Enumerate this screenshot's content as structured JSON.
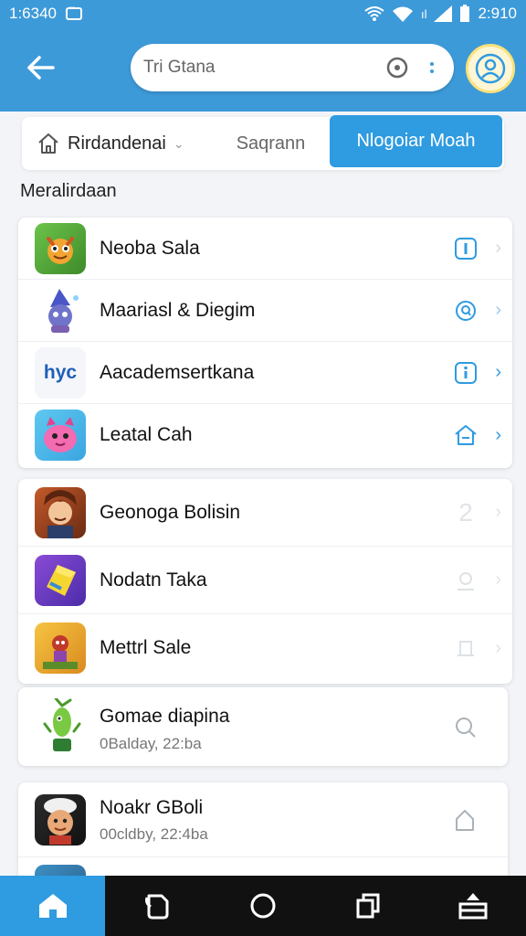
{
  "status_bar": {
    "time_left": "1:6340",
    "time_right": "2:910"
  },
  "search": {
    "placeholder": "Tri Gtana"
  },
  "tabs": {
    "home_label": "Rirdandenai",
    "second_label": "Saqrann",
    "active_button": "Nlogoiar Moah"
  },
  "section_title": "Meralirdaan",
  "group1": [
    {
      "title": "Neoba Sala",
      "action_icon": "info-icon"
    },
    {
      "title": "Maariasl & Diegim",
      "action_icon": "chat-icon"
    },
    {
      "title": "Aacademsertkana",
      "icon_text": "hyc",
      "action_icon": "info-icon"
    },
    {
      "title": "Leatal Cah",
      "action_icon": "home-icon"
    }
  ],
  "group2": [
    {
      "title": "Geonoga Bolisin"
    },
    {
      "title": "Nodatn Taka"
    },
    {
      "title": "Mettrl Sale"
    }
  ],
  "group3": {
    "title": "Gomae diapina",
    "subtitle": "0Baldaу, 22:ba"
  },
  "group4": {
    "title": "Noakr GBoli",
    "subtitle": "00cldby, 22:4ba"
  },
  "colors": {
    "accent": "#2f9be0",
    "header": "#3d9ad9"
  }
}
